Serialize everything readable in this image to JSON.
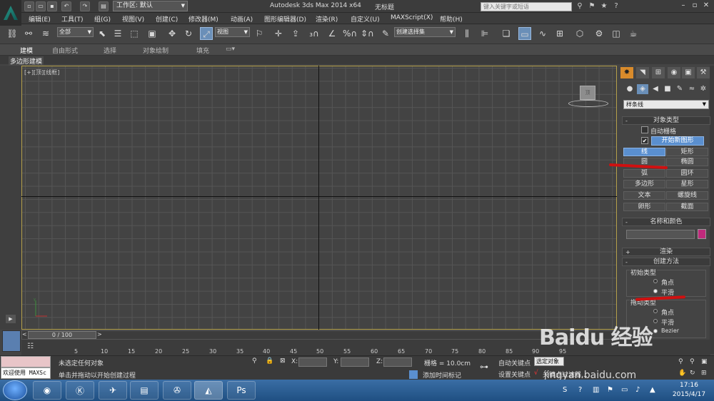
{
  "titlebar": {
    "workspace_label": "工作区: 默认",
    "app_title": "Autodesk 3ds Max  2014 x64",
    "doc_title": "无标题",
    "search_placeholder": "键入关键字或短语"
  },
  "menus": [
    "编辑(E)",
    "工具(T)",
    "组(G)",
    "视图(V)",
    "创建(C)",
    "修改器(M)",
    "动画(A)",
    "图形编辑器(D)",
    "渲染(R)",
    "自定义(U)",
    "MAXScript(X)",
    "帮助(H)"
  ],
  "toolbar": {
    "selection_filter": "全部",
    "ref_coord": "视图",
    "named_selection": "创建选择集"
  },
  "ribbon": {
    "tabs": [
      "建模",
      "自由形式",
      "选择",
      "对象绘制",
      "填充"
    ],
    "subtab": "多边形建模"
  },
  "viewport": {
    "label": "[+][顶][线框]",
    "viewcube_label": "顶"
  },
  "command_panel": {
    "category": "样条线",
    "object_type": {
      "title": "对象类型",
      "autogrid_label": "自动栅格",
      "start_new_shape_label": "开始新图形",
      "buttons": [
        "线",
        "矩形",
        "圆",
        "椭圆",
        "弧",
        "圆环",
        "多边形",
        "星形",
        "文本",
        "螺旋线",
        "卵形",
        "截面"
      ]
    },
    "name_color": {
      "title": "名称和颜色",
      "color": "#c02a7c"
    },
    "rendering": {
      "title": "渲染"
    },
    "creation_method": {
      "title": "创建方法",
      "initial_type": {
        "title": "初始类型",
        "options": [
          "角点",
          "平滑"
        ],
        "selected": "平滑"
      },
      "drag_type": {
        "title": "拖动类型",
        "options": [
          "角点",
          "平滑",
          "Bezier"
        ],
        "selected": "Bezier"
      }
    }
  },
  "timeline": {
    "slider": "0 / 100",
    "ticks": [
      "0",
      "5",
      "10",
      "15",
      "20",
      "25",
      "30",
      "35",
      "40",
      "45",
      "50",
      "55",
      "60",
      "65",
      "70",
      "75",
      "80",
      "85",
      "90",
      "95",
      "100"
    ]
  },
  "status": {
    "maxscript_listener": "欢迎使用 MAXSc",
    "selection_status": "未选定任何对象",
    "prompt": "单击并拖动以开始创建过程",
    "x_label": "X:",
    "y_label": "Y:",
    "z_label": "Z:",
    "grid": "栅格 = 10.0cm",
    "add_time_tag": "添加时间标记",
    "auto_key": "自动关键点",
    "set_key": "设置关键点",
    "selected": "选定对象",
    "key_filters": "关键点过滤器..."
  },
  "taskbar": {
    "time": "17:16",
    "date": "2015/4/17"
  },
  "watermark": {
    "logo": "Baidu 经验",
    "url": "jingyan.baidu.com"
  }
}
